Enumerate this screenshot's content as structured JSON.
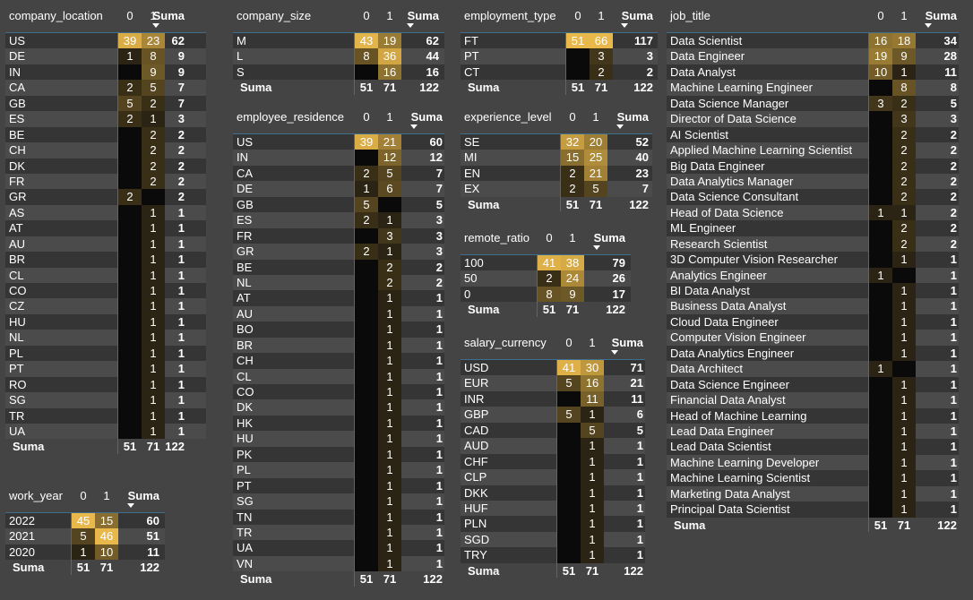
{
  "headers": {
    "col0": "0",
    "col1": "1",
    "total": "Suma",
    "total_row": "Suma"
  },
  "tables": {
    "company_location": {
      "dim": "company_location",
      "rows": [
        [
          "US",
          "39",
          "23",
          "62"
        ],
        [
          "DE",
          "1",
          "8",
          "9"
        ],
        [
          "IN",
          "",
          "9",
          "9"
        ],
        [
          "CA",
          "2",
          "5",
          "7"
        ],
        [
          "GB",
          "5",
          "2",
          "7"
        ],
        [
          "ES",
          "2",
          "1",
          "3"
        ],
        [
          "BE",
          "",
          "2",
          "2"
        ],
        [
          "CH",
          "",
          "2",
          "2"
        ],
        [
          "DK",
          "",
          "2",
          "2"
        ],
        [
          "FR",
          "",
          "2",
          "2"
        ],
        [
          "GR",
          "2",
          "",
          "2"
        ],
        [
          "AS",
          "",
          "1",
          "1"
        ],
        [
          "AT",
          "",
          "1",
          "1"
        ],
        [
          "AU",
          "",
          "1",
          "1"
        ],
        [
          "BR",
          "",
          "1",
          "1"
        ],
        [
          "CL",
          "",
          "1",
          "1"
        ],
        [
          "CO",
          "",
          "1",
          "1"
        ],
        [
          "CZ",
          "",
          "1",
          "1"
        ],
        [
          "HU",
          "",
          "1",
          "1"
        ],
        [
          "NL",
          "",
          "1",
          "1"
        ],
        [
          "PL",
          "",
          "1",
          "1"
        ],
        [
          "PT",
          "",
          "1",
          "1"
        ],
        [
          "RO",
          "",
          "1",
          "1"
        ],
        [
          "SG",
          "",
          "1",
          "1"
        ],
        [
          "TR",
          "",
          "1",
          "1"
        ],
        [
          "UA",
          "",
          "1",
          "1"
        ]
      ],
      "sum": [
        "51",
        "71",
        "122"
      ]
    },
    "work_year": {
      "dim": "work_year",
      "rows": [
        [
          "2022",
          "45",
          "15",
          "60"
        ],
        [
          "2021",
          "5",
          "46",
          "51"
        ],
        [
          "2020",
          "1",
          "10",
          "11"
        ]
      ],
      "sum": [
        "51",
        "71",
        "122"
      ]
    },
    "company_size": {
      "dim": "company_size",
      "rows": [
        [
          "M",
          "43",
          "19",
          "62"
        ],
        [
          "L",
          "8",
          "36",
          "44"
        ],
        [
          "S",
          "",
          "16",
          "16"
        ]
      ],
      "sum": [
        "51",
        "71",
        "122"
      ]
    },
    "employee_residence": {
      "dim": "employee_residence",
      "rows": [
        [
          "US",
          "39",
          "21",
          "60"
        ],
        [
          "IN",
          "",
          "12",
          "12"
        ],
        [
          "CA",
          "2",
          "5",
          "7"
        ],
        [
          "DE",
          "1",
          "6",
          "7"
        ],
        [
          "GB",
          "5",
          "",
          "5"
        ],
        [
          "ES",
          "2",
          "1",
          "3"
        ],
        [
          "FR",
          "",
          "3",
          "3"
        ],
        [
          "GR",
          "2",
          "1",
          "3"
        ],
        [
          "BE",
          "",
          "2",
          "2"
        ],
        [
          "NL",
          "",
          "2",
          "2"
        ],
        [
          "AT",
          "",
          "1",
          "1"
        ],
        [
          "AU",
          "",
          "1",
          "1"
        ],
        [
          "BO",
          "",
          "1",
          "1"
        ],
        [
          "BR",
          "",
          "1",
          "1"
        ],
        [
          "CH",
          "",
          "1",
          "1"
        ],
        [
          "CL",
          "",
          "1",
          "1"
        ],
        [
          "CO",
          "",
          "1",
          "1"
        ],
        [
          "DK",
          "",
          "1",
          "1"
        ],
        [
          "HK",
          "",
          "1",
          "1"
        ],
        [
          "HU",
          "",
          "1",
          "1"
        ],
        [
          "PK",
          "",
          "1",
          "1"
        ],
        [
          "PL",
          "",
          "1",
          "1"
        ],
        [
          "PT",
          "",
          "1",
          "1"
        ],
        [
          "SG",
          "",
          "1",
          "1"
        ],
        [
          "TN",
          "",
          "1",
          "1"
        ],
        [
          "TR",
          "",
          "1",
          "1"
        ],
        [
          "UA",
          "",
          "1",
          "1"
        ],
        [
          "VN",
          "",
          "1",
          "1"
        ]
      ],
      "sum": [
        "51",
        "71",
        "122"
      ]
    },
    "employment_type": {
      "dim": "employment_type",
      "rows": [
        [
          "FT",
          "51",
          "66",
          "117"
        ],
        [
          "PT",
          "",
          "3",
          "3"
        ],
        [
          "CT",
          "",
          "2",
          "2"
        ]
      ],
      "sum": [
        "51",
        "71",
        "122"
      ]
    },
    "experience_level": {
      "dim": "experience_level",
      "rows": [
        [
          "SE",
          "32",
          "20",
          "52"
        ],
        [
          "MI",
          "15",
          "25",
          "40"
        ],
        [
          "EN",
          "2",
          "21",
          "23"
        ],
        [
          "EX",
          "2",
          "5",
          "7"
        ]
      ],
      "sum": [
        "51",
        "71",
        "122"
      ]
    },
    "remote_ratio": {
      "dim": "remote_ratio",
      "rows": [
        [
          "100",
          "41",
          "38",
          "79"
        ],
        [
          "50",
          "2",
          "24",
          "26"
        ],
        [
          "0",
          "8",
          "9",
          "17"
        ]
      ],
      "sum": [
        "51",
        "71",
        "122"
      ]
    },
    "salary_currency": {
      "dim": "salary_currency",
      "rows": [
        [
          "USD",
          "41",
          "30",
          "71"
        ],
        [
          "EUR",
          "5",
          "16",
          "21"
        ],
        [
          "INR",
          "",
          "11",
          "11"
        ],
        [
          "GBP",
          "5",
          "1",
          "6"
        ],
        [
          "CAD",
          "",
          "5",
          "5"
        ],
        [
          "AUD",
          "",
          "1",
          "1"
        ],
        [
          "CHF",
          "",
          "1",
          "1"
        ],
        [
          "CLP",
          "",
          "1",
          "1"
        ],
        [
          "DKK",
          "",
          "1",
          "1"
        ],
        [
          "HUF",
          "",
          "1",
          "1"
        ],
        [
          "PLN",
          "",
          "1",
          "1"
        ],
        [
          "SGD",
          "",
          "1",
          "1"
        ],
        [
          "TRY",
          "",
          "1",
          "1"
        ]
      ],
      "sum": [
        "51",
        "71",
        "122"
      ]
    },
    "job_title": {
      "dim": "job_title",
      "rows": [
        [
          "Data Scientist",
          "16",
          "18",
          "34"
        ],
        [
          "Data Engineer",
          "19",
          "9",
          "28"
        ],
        [
          "Data Analyst",
          "10",
          "1",
          "11"
        ],
        [
          "Machine Learning Engineer",
          "",
          "8",
          "8"
        ],
        [
          "Data Science Manager",
          "3",
          "2",
          "5"
        ],
        [
          "Director of Data Science",
          "",
          "3",
          "3"
        ],
        [
          "AI Scientist",
          "",
          "2",
          "2"
        ],
        [
          "Applied Machine Learning Scientist",
          "",
          "2",
          "2"
        ],
        [
          "Big Data Engineer",
          "",
          "2",
          "2"
        ],
        [
          "Data Analytics Manager",
          "",
          "2",
          "2"
        ],
        [
          "Data Science Consultant",
          "",
          "2",
          "2"
        ],
        [
          "Head of Data Science",
          "1",
          "1",
          "2"
        ],
        [
          "ML Engineer",
          "",
          "2",
          "2"
        ],
        [
          "Research Scientist",
          "",
          "2",
          "2"
        ],
        [
          "3D Computer Vision Researcher",
          "",
          "1",
          "1"
        ],
        [
          "Analytics Engineer",
          "1",
          "",
          "1"
        ],
        [
          "BI Data Analyst",
          "",
          "1",
          "1"
        ],
        [
          "Business Data Analyst",
          "",
          "1",
          "1"
        ],
        [
          "Cloud Data Engineer",
          "",
          "1",
          "1"
        ],
        [
          "Computer Vision Engineer",
          "",
          "1",
          "1"
        ],
        [
          "Data Analytics Engineer",
          "",
          "1",
          "1"
        ],
        [
          "Data Architect",
          "1",
          "",
          "1"
        ],
        [
          "Data Science Engineer",
          "",
          "1",
          "1"
        ],
        [
          "Financial Data Analyst",
          "",
          "1",
          "1"
        ],
        [
          "Head of Machine Learning",
          "",
          "1",
          "1"
        ],
        [
          "Lead Data Engineer",
          "",
          "1",
          "1"
        ],
        [
          "Lead Data Scientist",
          "",
          "1",
          "1"
        ],
        [
          "Machine Learning Developer",
          "",
          "1",
          "1"
        ],
        [
          "Machine Learning Scientist",
          "",
          "1",
          "1"
        ],
        [
          "Marketing Data Analyst",
          "",
          "1",
          "1"
        ],
        [
          "Principal Data Scientist",
          "",
          "1",
          "1"
        ]
      ],
      "sum": [
        "51",
        "71",
        "122"
      ]
    }
  },
  "colors": {
    "background": "#444444",
    "row_dark": "#353535",
    "row_light": "#4b4b4b",
    "heat_low": "#0a0a0a",
    "heat_high": "#e8b84a",
    "divider": "#3f6f8f"
  }
}
